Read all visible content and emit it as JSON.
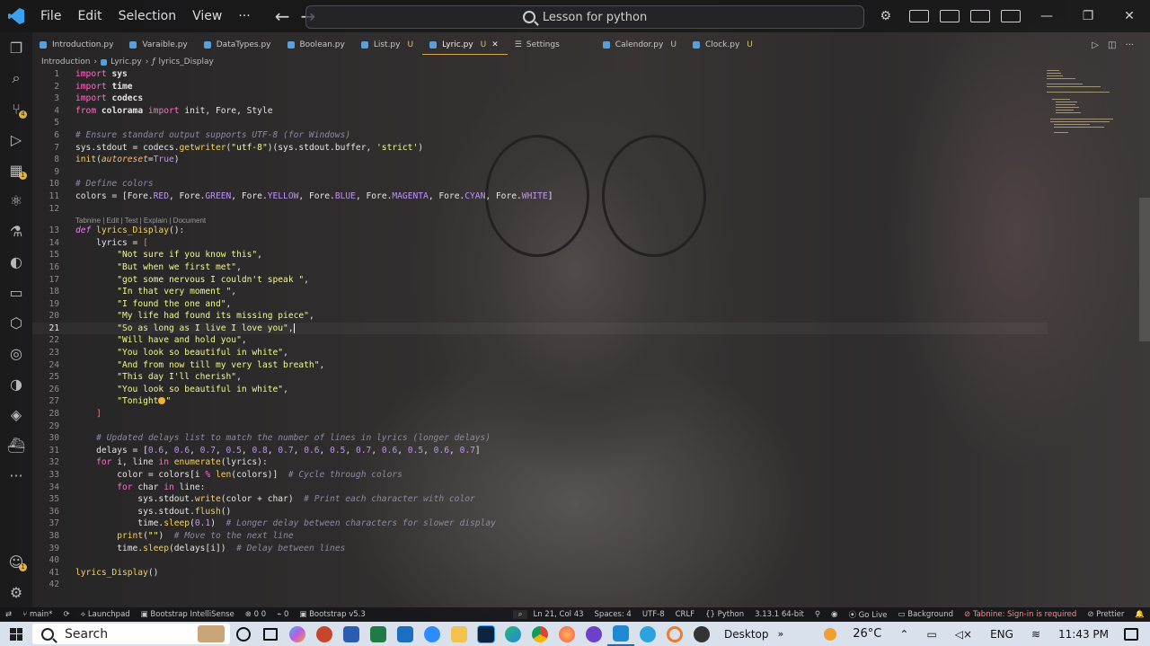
{
  "titlebar": {
    "menus": [
      "File",
      "Edit",
      "Selection",
      "View",
      "···"
    ],
    "search_text": "Lesson for python"
  },
  "tabs": [
    {
      "label": "Introduction.py",
      "flag": ""
    },
    {
      "label": "Varaible.py",
      "flag": ""
    },
    {
      "label": "DataTypes.py",
      "flag": ""
    },
    {
      "label": "Boolean.py",
      "flag": ""
    },
    {
      "label": "List.py",
      "flag": "U"
    },
    {
      "label": "Lyric.py",
      "flag": "U",
      "active": true
    },
    {
      "label": "Settings",
      "flag": ""
    },
    {
      "label": "Calendor.py",
      "flag": "U"
    },
    {
      "label": "Clock.py",
      "flag": "U"
    }
  ],
  "breadcrumb": {
    "folder": "Introduction",
    "file": "Lyric.py",
    "symbol": "lyrics_Display"
  },
  "codelens": "Tabnine | Edit | Test | Explain | Document",
  "editor": {
    "current_line": 21,
    "line_count": 42
  },
  "status": {
    "branch": "main*",
    "launchpad": "Launchpad",
    "bootstrap_intellisense": "Bootstrap IntelliSense",
    "problems": "0  0",
    "ports": "0",
    "bootstrap_version": "Bootstrap v5.3",
    "position": "Ln 21, Col 43",
    "spaces": "Spaces: 4",
    "encoding": "UTF-8",
    "eol": "CRLF",
    "language": "Python",
    "interpreter": "3.13.1 64-bit",
    "golive": "Go Live",
    "background": "Background",
    "tabnine": "Tabnine: Sign-in is required",
    "prettier": "Prettier"
  },
  "taskbar": {
    "search": "Search",
    "desktop": "Desktop",
    "temperature": "26°C",
    "language": "ENG",
    "time": "11:43 PM"
  },
  "colors": {
    "keyword": "#ff6ec7",
    "string": "#f1fa8c",
    "comment": "#8d8aa0",
    "accent": "#3aa0f0"
  }
}
